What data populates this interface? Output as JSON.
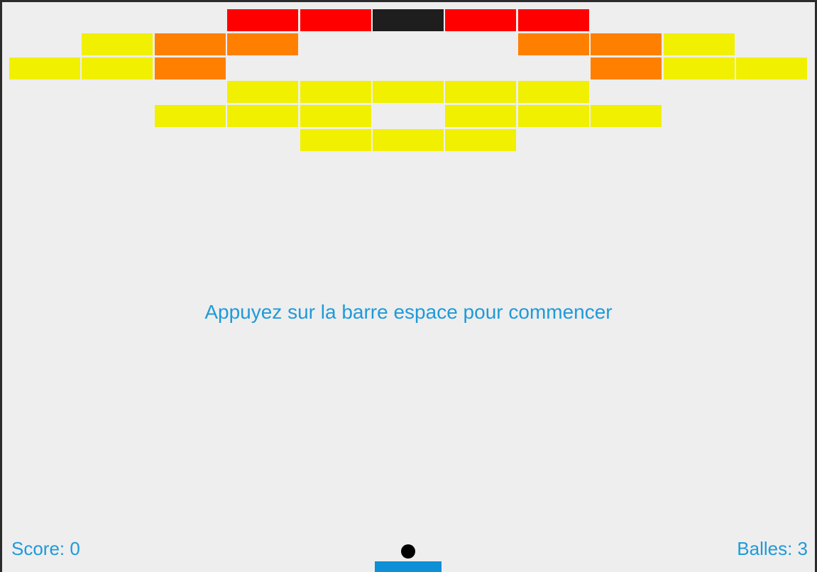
{
  "hud": {
    "score_label": "Score: 0",
    "balls_label": "Balles: 3"
  },
  "message": "Appuyez sur la barre espace pour commencer",
  "colors": {
    "background": "#eeeeee",
    "text": "#1f9ad9",
    "paddle": "#0f8fd6",
    "ball": "#000000",
    "red": "#ff0000",
    "orange": "#ff8000",
    "yellow": "#f0f000",
    "black": "#1e1e1e"
  },
  "bricks": [
    [
      null,
      null,
      null,
      "red",
      "red",
      "black",
      "red",
      "red",
      null,
      null,
      null
    ],
    [
      null,
      "yellow",
      "orange",
      "orange",
      null,
      null,
      null,
      "orange",
      "orange",
      "yellow",
      null
    ],
    [
      "yellow",
      "yellow",
      "orange",
      null,
      null,
      null,
      null,
      null,
      "orange",
      "yellow",
      "yellow"
    ],
    [
      null,
      null,
      null,
      "yellow",
      "yellow",
      "yellow",
      "yellow",
      "yellow",
      null,
      null,
      null
    ],
    [
      null,
      null,
      "yellow",
      "yellow",
      "yellow",
      null,
      "yellow",
      "yellow",
      "yellow",
      null,
      null
    ],
    [
      null,
      null,
      null,
      null,
      "yellow",
      "yellow",
      "yellow",
      null,
      null,
      null,
      null
    ]
  ]
}
